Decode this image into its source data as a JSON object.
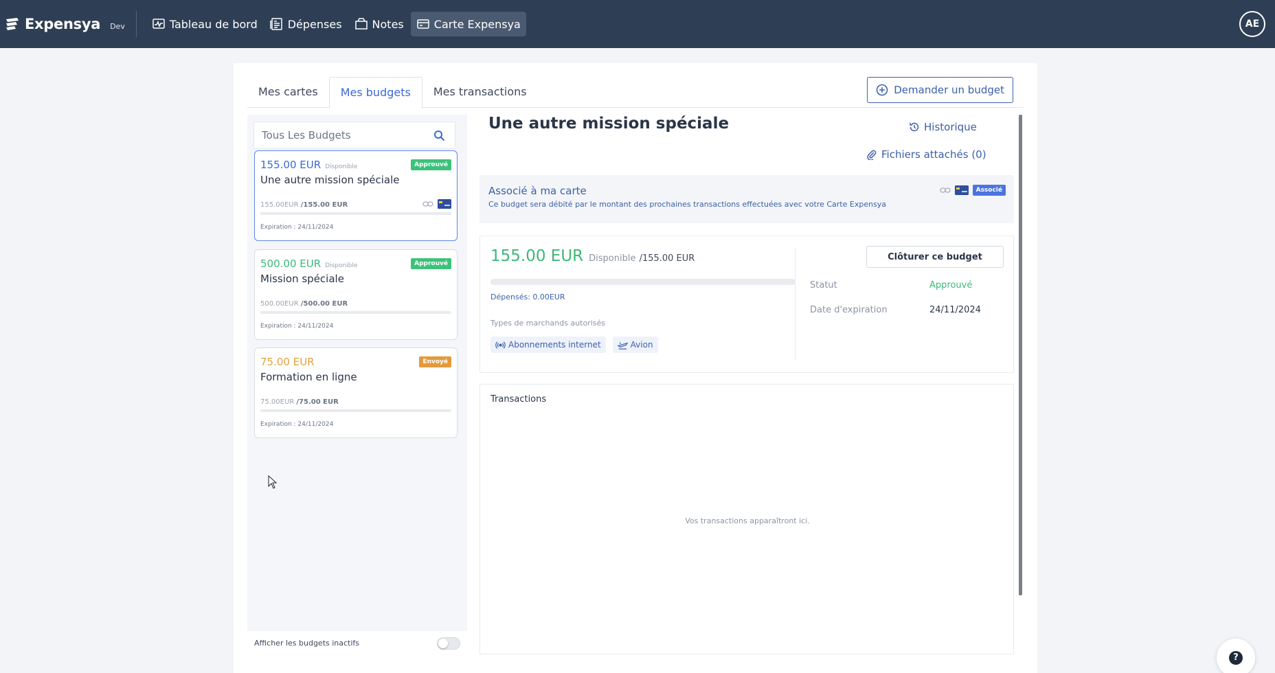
{
  "app": {
    "name": "Expensya",
    "env": "Dev"
  },
  "nav": [
    {
      "label": "Tableau de bord",
      "icon": "dashboard-icon"
    },
    {
      "label": "Dépenses",
      "icon": "receipt-icon"
    },
    {
      "label": "Notes",
      "icon": "folder-icon"
    },
    {
      "label": "Carte Expensya",
      "icon": "credit-card-icon",
      "active": true
    }
  ],
  "user": {
    "initials": "AE"
  },
  "tabs": [
    {
      "label": "Mes cartes"
    },
    {
      "label": "Mes budgets",
      "active": true
    },
    {
      "label": "Mes transactions"
    }
  ],
  "request_budget_label": "Demander un budget",
  "search": {
    "placeholder": "Tous Les Budgets"
  },
  "budgets": [
    {
      "amount": "155.00 EUR",
      "available_label": "Disponible",
      "title": "Une autre mission spéciale",
      "badge": "Approuvé",
      "ratio_used": "155.00EUR",
      "ratio_total": "/155.00 EUR",
      "expiration": "Expiration : 24/11/2024",
      "color": "#3b68d8",
      "badge_color": "#3cc27a",
      "selected": true
    },
    {
      "amount": "500.00 EUR",
      "available_label": "Disponible",
      "title": "Mission spéciale",
      "badge": "Approuvé",
      "ratio_used": "500.00EUR",
      "ratio_total": "/500.00 EUR",
      "expiration": "Expiration : 24/11/2024",
      "color": "#3cb878",
      "badge_color": "#3cc27a"
    },
    {
      "amount": "75.00 EUR",
      "available_label": "",
      "title": "Formation en ligne",
      "badge": "Envoyé",
      "ratio_used": "75.00EUR",
      "ratio_total": "/75.00 EUR",
      "expiration": "Expiration : 24/11/2024",
      "color": "#e0a23c",
      "badge_color": "#e39a3b"
    }
  ],
  "inactive_label": "Afficher les budgets inactifs",
  "detail": {
    "title": "Une autre mission spéciale",
    "history_label": "Historique",
    "attachments_label": "Fichiers attachés (0)",
    "assoc_title": "Associé à ma carte",
    "assoc_text": "Ce budget sera débité par le montant des prochaines transactions effectuées avec votre Carte Expensya",
    "assoc_badge": "Associé",
    "available_amount": "155.00 EUR",
    "available_label": "Disponible",
    "total": "/155.00 EUR",
    "spent": "Dépensés: 0.00EUR",
    "merchant_types_label": "Types de marchands autorisés",
    "merchants": [
      "Abonnements internet",
      "Avion"
    ],
    "close_label": "Clôturer ce budget",
    "status_label": "Statut",
    "status_value": "Approuvé",
    "status_color": "#3cb878",
    "expiration_label": "Date d'expiration",
    "expiration_value": "24/11/2024",
    "transactions_title": "Transactions",
    "transactions_empty": "Vos transactions apparaîtront ici."
  },
  "help_label": "?"
}
